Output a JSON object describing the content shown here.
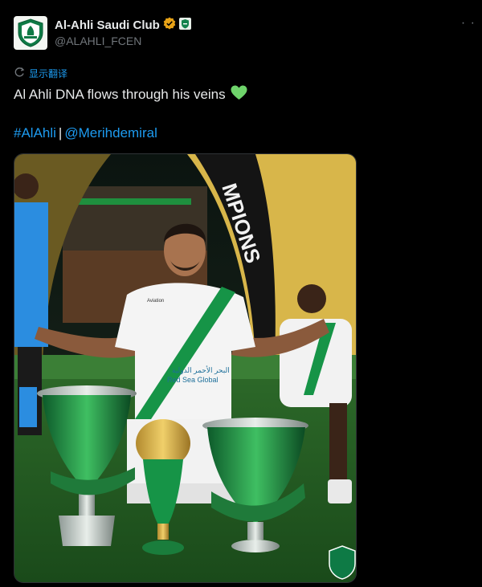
{
  "account": {
    "name": "Al-Ahli Saudi Club",
    "handle": "@ALAHLI_FCEN",
    "verified": true,
    "verified_color": "#e8a317",
    "affiliate_badge_color": "#12824b"
  },
  "translate": {
    "label": "显示翻译",
    "icon": "translate-icon"
  },
  "tweet": {
    "text": "Al Ahli DNA flows through his veins",
    "emoji": "green-heart-icon",
    "hashtag": "#AlAhli",
    "separator": "|",
    "mention": "@Merihdemiral"
  },
  "media": {
    "alt_subject": "photo",
    "banner_text": "MPIONS",
    "sponsor_text": "Red Sea Global",
    "sponsor_arabic": "البحر الأحمر الدولية",
    "shirt_brand": "Aviation"
  },
  "colors": {
    "accent_link": "#1d9bf0",
    "text_primary": "#e7e9ea",
    "text_secondary": "#71767b",
    "club_green": "#0e7a45",
    "trophy_gold": "#d6a93a"
  }
}
